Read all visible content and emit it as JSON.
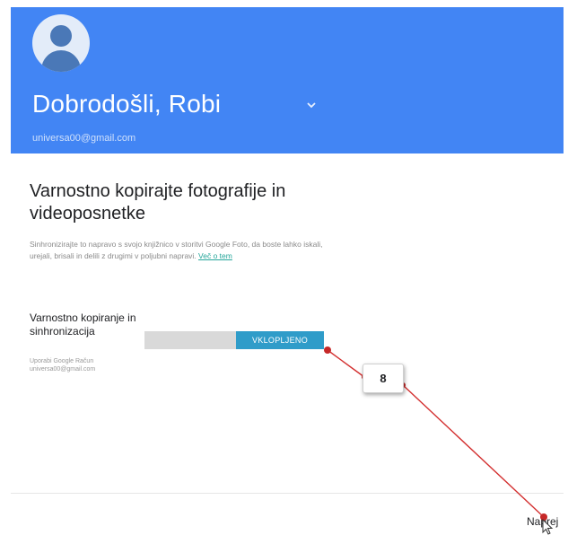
{
  "header": {
    "welcome_text": "Dobrodošli, Robi",
    "email": "universa00@gmail.com",
    "background_color": "#4285f4",
    "avatar_icon": "account-circle-icon",
    "dropdown_icon": "chevron-down-icon"
  },
  "main": {
    "title": "Varnostno kopirajte fotografije in videoposnetke",
    "description": "Sinhronizirajte to napravo s svojo knjižnico v storitvi Google Foto, da boste lahko iskali, urejali, brisali in delili z drugimi v poljubni napravi.",
    "learn_more_link": "Več o tem"
  },
  "setting": {
    "label": "Varnostno kopiranje in sinhronizacija",
    "sub_line1": "Uporabi Google Račun",
    "sub_line2": "universa00@gmail.com",
    "toggle_state_label": "VKLOPLJENO",
    "toggle_on_color": "#2f9cc9"
  },
  "footer": {
    "next_label": "Naprej"
  },
  "annotation": {
    "step_number": "8",
    "line_color": "#d32f2f",
    "cursor_icon": "mouse-pointer-icon"
  }
}
